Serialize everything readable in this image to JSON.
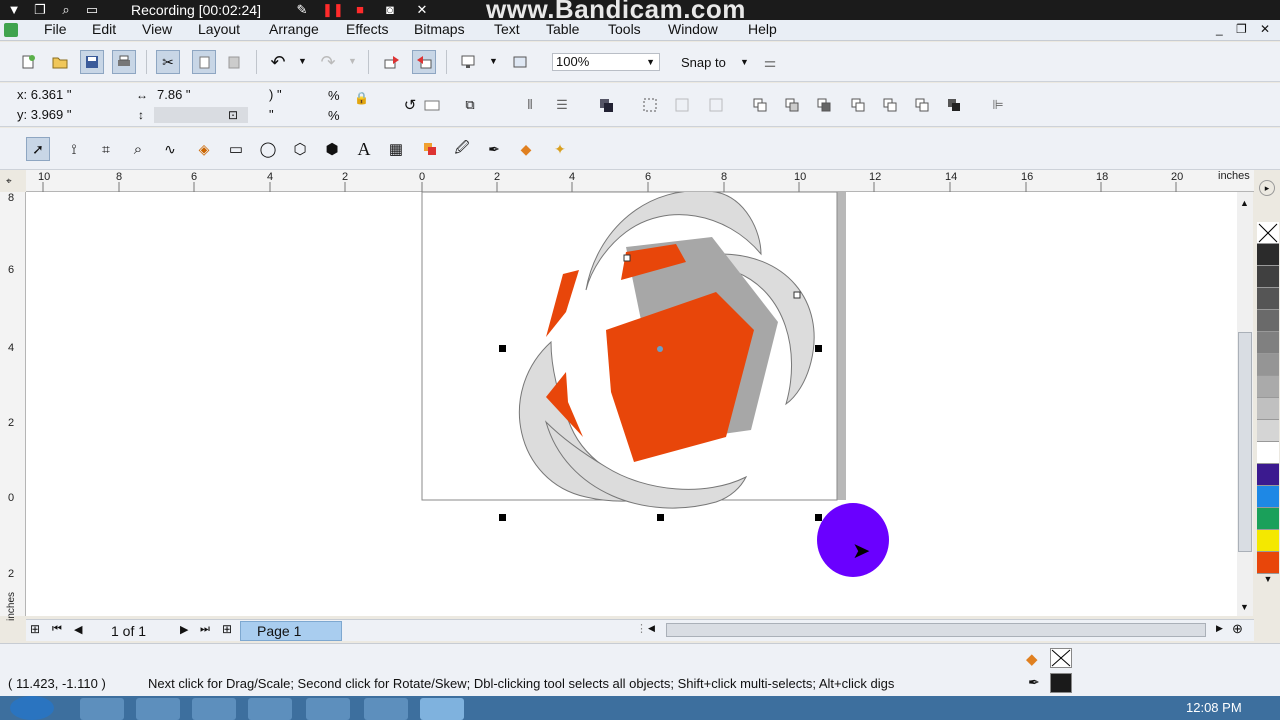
{
  "title_bar": {
    "recording": "Recording [00:02:24]",
    "watermark": "www.Bandicam.com"
  },
  "menu": [
    "File",
    "Edit",
    "View",
    "Layout",
    "Arrange",
    "Effects",
    "Bitmaps",
    "Text",
    "Table",
    "Tools",
    "Window",
    "Help"
  ],
  "standard_toolbar": {
    "zoom": "100%",
    "snap": "Snap to"
  },
  "property_bar": {
    "x": "x: 6.361 \"",
    "y": "y: 3.969 \"",
    "width": "7.86 \"",
    "scale_x": ") \"",
    "scale_y": "\"",
    "percent_1": "%",
    "percent_2": "%"
  },
  "hruler": {
    "unit": "inches",
    "ticks": [
      "10",
      "8",
      "6",
      "4",
      "2",
      "0",
      "2",
      "4",
      "6",
      "8",
      "10",
      "12",
      "14",
      "16",
      "18",
      "20"
    ]
  },
  "vruler": {
    "unit": "inches",
    "ticks": [
      "8",
      "6",
      "4",
      "2",
      "0",
      "2"
    ]
  },
  "page_nav": {
    "count": "1 of 1",
    "tab": "Page 1"
  },
  "status": {
    "coords": "( 11.423, -1.110 )",
    "hint": "Next click for Drag/Scale; Second click for Rotate/Skew; Dbl-clicking tool selects all objects; Shift+click multi-selects; Alt+click digs"
  },
  "taskbar": {
    "clock": "12:08 PM"
  },
  "colors": {
    "orange": "#e8460a",
    "gray": "#a7a7a7",
    "light_gray": "#dcdcdc",
    "cursor": "#6a00ff",
    "page_tab": "#a9cdef"
  },
  "palette": [
    "#2b2b2b",
    "#404040",
    "#555555",
    "#6a6a6a",
    "#808080",
    "#959595",
    "#aaaaaa",
    "#c0c0c0",
    "#d5d5d5",
    "#ffffff",
    "#3b1a8f",
    "#1e88e5",
    "#1aa05a",
    "#f4e800",
    "#e8460a"
  ]
}
